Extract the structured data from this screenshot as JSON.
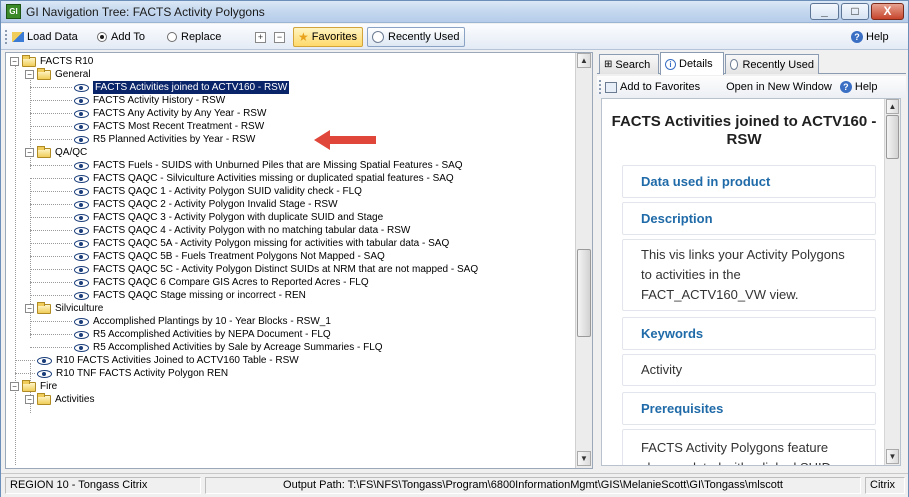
{
  "window": {
    "app_icon_text": "GI",
    "title": "GI Navigation Tree: FACTS Activity Polygons",
    "minimize": "_",
    "maximize": "□",
    "close": "X"
  },
  "toolbar": {
    "load_data": "Load Data",
    "add_to": "Add To",
    "replace": "Replace",
    "load_mode_selected": "Add To",
    "expand_all": "+",
    "collapse_all": "−",
    "favorites": "Favorites",
    "recently_used": "Recently Used",
    "help": "Help"
  },
  "tree": {
    "root": "FACTS R10",
    "groups": [
      {
        "label": "General",
        "items": [
          "FACTS Activities joined to ACTV160 - RSW",
          "FACTS Activity History - RSW",
          "FACTS Any Activity by Any Year - RSW",
          "FACTS Most Recent Treatment - RSW",
          "R5 Planned Activities by Year - RSW"
        ]
      },
      {
        "label": "QA/QC",
        "items": [
          "FACTS Fuels - SUIDS with Unburned Piles that are Missing Spatial Features - SAQ",
          "FACTS QAQC - Silviculture Activities missing or duplicated spatial features - SAQ",
          "FACTS QAQC 1 - Activity Polygon SUID validity check - FLQ",
          "FACTS QAQC 2 - Activity Polygon Invalid Stage - RSW",
          "FACTS QAQC 3 - Activity Polygon with duplicate SUID and Stage",
          "FACTS QAQC 4 - Activity Polygon with no matching tabular data - RSW",
          "FACTS QAQC 5A - Activity Polygon missing for activities with tabular data - SAQ",
          "FACTS QAQC 5B - Fuels Treatment Polygons Not Mapped - SAQ",
          "FACTS QAQC 5C - Activity Polygon Distinct SUIDs at NRM that are not mapped - SAQ",
          "FACTS QAQC 6 Compare GIS Acres to Reported Acres - FLQ",
          "FACTS QAQC Stage missing or incorrect - REN"
        ]
      },
      {
        "label": "Silviculture",
        "items": [
          "Accomplished Plantings by 10 - Year Blocks - RSW_1",
          "R5 Accomplished Activities by NEPA Document - FLQ",
          "R5 Accomplished Activities by Sale by Acreage Summaries - FLQ"
        ]
      }
    ],
    "root_items": [
      "R10 FACTS Activities Joined to ACTV160 Table - RSW",
      "R10 TNF FACTS Activity Polygon REN"
    ],
    "fire": "Fire",
    "activities": "Activities",
    "selected_item": "FACTS Activities joined to ACTV160 - RSW"
  },
  "right_panel": {
    "tabs": [
      "Search",
      "Details",
      "Recently Used"
    ],
    "active_tab": "Details",
    "add_to_favorites": "Add to Favorites",
    "open_new_window": "Open in New Window",
    "help": "Help",
    "title": "FACTS Activities joined to ACTV160 - RSW",
    "sections": {
      "data_used": "Data used in product",
      "description_head": "Description",
      "description_body": "This vis links your Activity Polygons to activities in the FACT_ACTV160_VW view.",
      "keywords_head": "Keywords",
      "keywords_body": "Activity",
      "prerequisites_head": "Prerequisites",
      "prerequisites_body": "FACTS Activity Polygons feature class updated with a linked SUID"
    }
  },
  "statusbar": {
    "region": "REGION 10 - Tongass Citrix",
    "output_path": "Output Path: T:\\FS\\NFS\\Tongass\\Program\\6800InformationMgmt\\GIS\\MelanieScott\\GI\\Tongass\\mlscott",
    "citrix": "Citrix"
  },
  "colors": {
    "selection": "#0a246a",
    "arrow": "#e0473a",
    "section_heading": "#1f6aa8",
    "folder": "#f0cd5a",
    "eye": "#1a3d7a"
  }
}
